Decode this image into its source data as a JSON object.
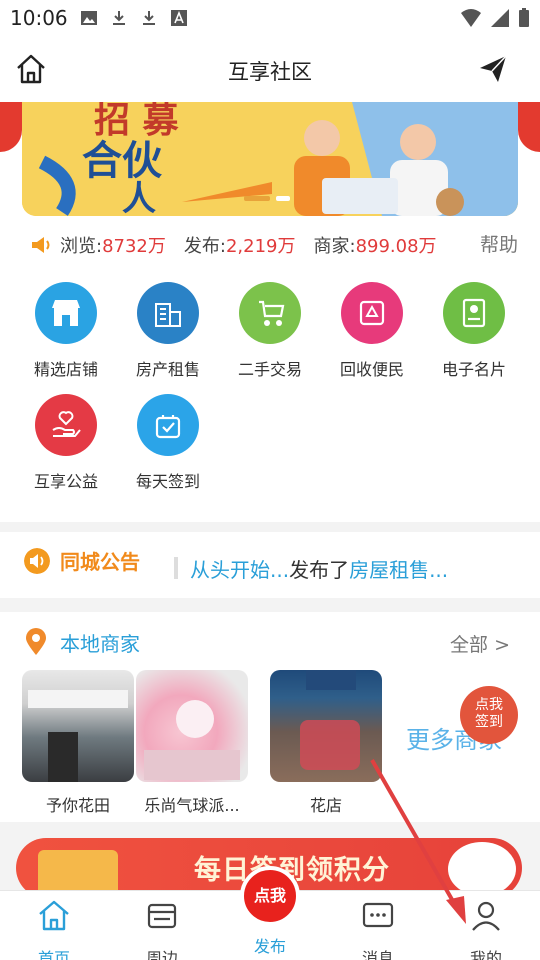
{
  "status_bar": {
    "time": "10:06"
  },
  "header": {
    "title": "互享社区"
  },
  "stats": {
    "browse_label": "浏览:",
    "browse_value": "8732万",
    "publish_label": "发布:",
    "publish_value": "2,219万",
    "merchant_label": "商家:",
    "merchant_value": "899.08万",
    "help_label": "帮助"
  },
  "grid": [
    {
      "label": "精选店铺",
      "color": "#2aa3e3"
    },
    {
      "label": "房产租售",
      "color": "#2a82c6"
    },
    {
      "label": "二手交易",
      "color": "#7cc24b"
    },
    {
      "label": "回收便民",
      "color": "#e73a7b"
    },
    {
      "label": "电子名片",
      "color": "#6fbe45"
    },
    {
      "label": "互享公益",
      "color": "#e43a45"
    },
    {
      "label": "每天签到",
      "color": "#2ba4e8"
    }
  ],
  "notice": {
    "title": "同城公告",
    "user": "从头开始...",
    "middle": "发布了",
    "topic": "房屋租售..."
  },
  "local": {
    "title": "本地商家",
    "all_label": "全部 >",
    "shops": [
      {
        "name": "予你花田"
      },
      {
        "name": "乐尚气球派..."
      },
      {
        "name": "花店"
      }
    ],
    "more_label": "更多商家"
  },
  "float_sign": {
    "line1": "点我",
    "line2": "签到"
  },
  "promo": {
    "text": "每日签到领积分"
  },
  "tabbar": {
    "home": "首页",
    "nearby": "周边",
    "post_button": "点我",
    "post": "发布",
    "messages": "消息",
    "mine": "我的"
  }
}
